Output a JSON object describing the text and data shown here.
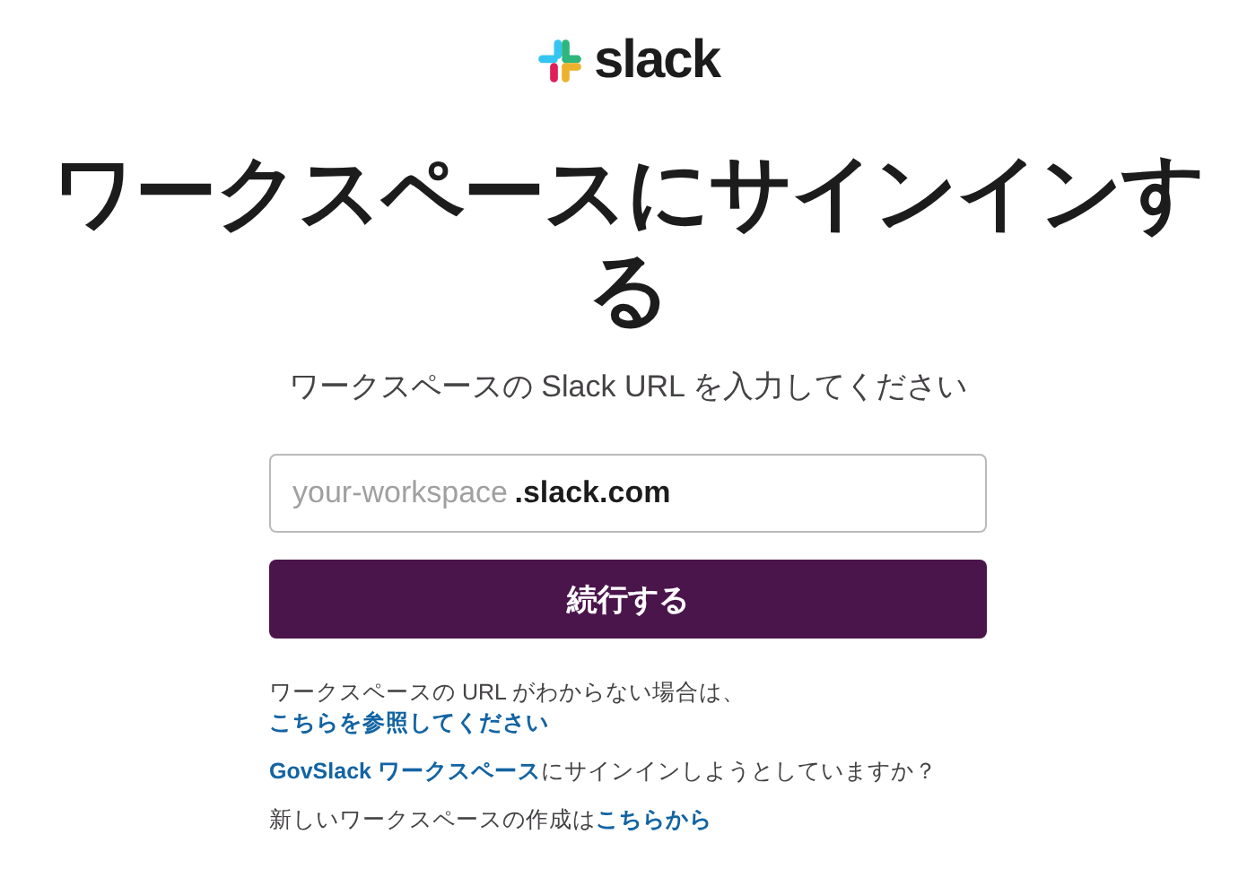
{
  "logo": {
    "text": "slack"
  },
  "title": "ワークスペースにサインインする",
  "subtitle": "ワークスペースの Slack URL を入力してください",
  "url_field": {
    "placeholder": "your-workspace",
    "suffix": ".slack.com"
  },
  "continue_button": "続行する",
  "help_lines": [
    {
      "before": "ワークスペースの URL がわからない場合は、",
      "link": "こちらを参照してください"
    },
    {
      "link": "GovSlack **ワークスペース**",
      "after": "にサインインしようとしていますか？"
    },
    {
      "before": "新しいワークスペースの作成は",
      "link": "こちらから"
    }
  ]
}
